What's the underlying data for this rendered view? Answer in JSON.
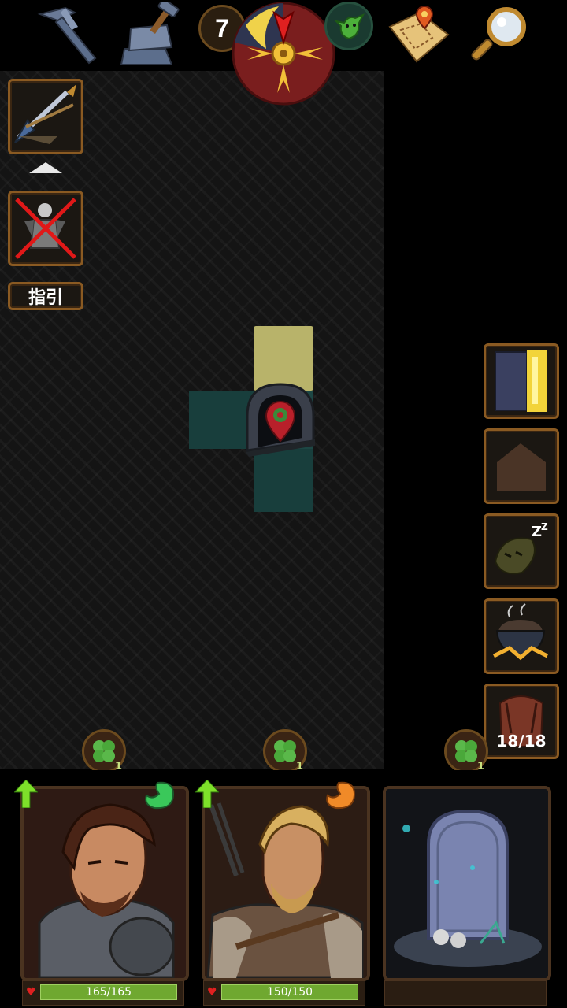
{
  "top_bar": {
    "day_counter": "7",
    "icons": [
      "pickaxe-icon",
      "anvil-icon",
      "day-night-compass-icon",
      "goblin-face-icon",
      "map-scroll-icon",
      "magnifier-icon"
    ]
  },
  "left_panel": {
    "guide_label": "指引"
  },
  "right_panel": {
    "carry_capacity": "18/18"
  },
  "party": [
    {
      "hp": "165/165"
    },
    {
      "hp": "150/150"
    }
  ],
  "clover_badges": [
    {
      "count": "1"
    },
    {
      "count": "1"
    },
    {
      "count": "1"
    }
  ]
}
